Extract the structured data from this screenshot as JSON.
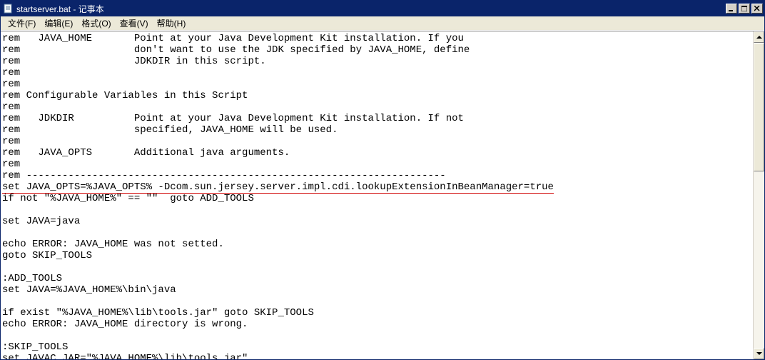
{
  "window": {
    "title": "startserver.bat - 记事本"
  },
  "menu": {
    "file": "文件(F)",
    "edit": "编辑(E)",
    "format": "格式(O)",
    "view": "查看(V)",
    "help": "帮助(H)"
  },
  "content": {
    "line01": "rem   JAVA_HOME       Point at your Java Development Kit installation. If you",
    "line02": "rem                   don't want to use the JDK specified by JAVA_HOME, define",
    "line03": "rem                   JDKDIR in this script.",
    "line04": "rem",
    "line05": "rem",
    "line06": "rem Configurable Variables in this Script",
    "line07": "rem",
    "line08": "rem   JDKDIR          Point at your Java Development Kit installation. If not",
    "line09": "rem                   specified, JAVA_HOME will be used.",
    "line10": "rem",
    "line11": "rem   JAVA_OPTS       Additional java arguments.",
    "line12": "rem",
    "line13": "rem ----------------------------------------------------------------------",
    "line14": "set JAVA_OPTS=%JAVA_OPTS% -Dcom.sun.jersey.server.impl.cdi.lookupExtensionInBeanManager=true",
    "line15": "if not \"%JAVA_HOME%\" == \"\"  goto ADD_TOOLS",
    "line16": "",
    "line17": "set JAVA=java",
    "line18": "",
    "line19": "echo ERROR: JAVA_HOME was not setted.",
    "line20": "goto SKIP_TOOLS",
    "line21": "",
    "line22": ":ADD_TOOLS",
    "line23": "set JAVA=%JAVA_HOME%\\bin\\java",
    "line24": "",
    "line25": "if exist \"%JAVA_HOME%\\lib\\tools.jar\" goto SKIP_TOOLS",
    "line26": "echo ERROR: JAVA_HOME directory is wrong.",
    "line27": "",
    "line28": ":SKIP_TOOLS",
    "line29": "set JAVAC_JAR=\"%JAVA_HOME%\\lib\\tools.jar\""
  }
}
